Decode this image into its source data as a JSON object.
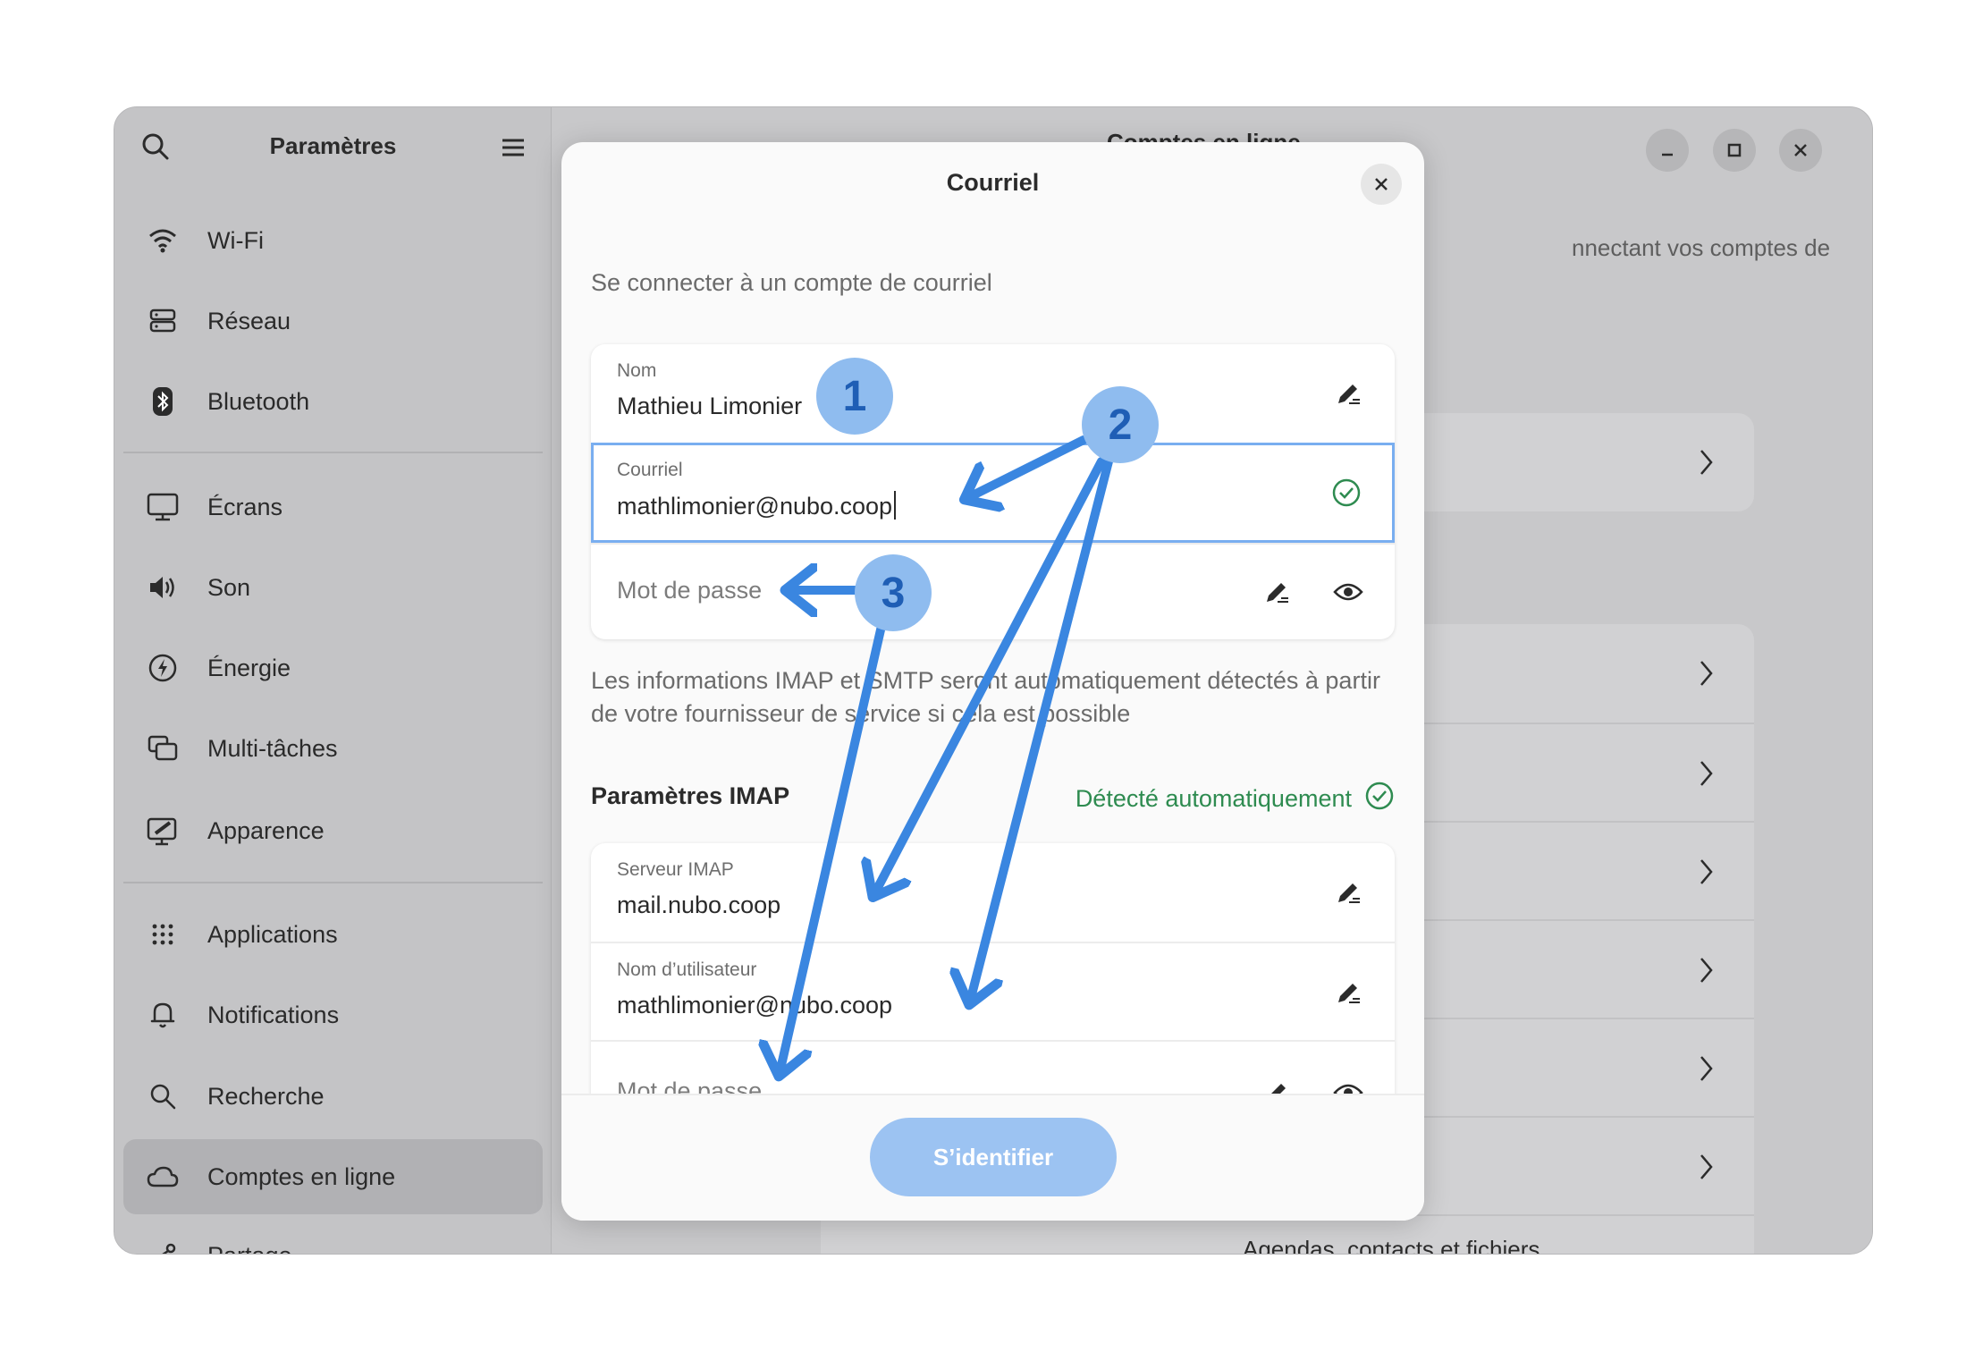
{
  "sidebar": {
    "title": "Paramètres",
    "items": [
      {
        "label": "Wi-Fi",
        "icon": "wifi-icon"
      },
      {
        "label": "Réseau",
        "icon": "network-icon"
      },
      {
        "label": "Bluetooth",
        "icon": "bluetooth-icon"
      },
      {
        "label": "Écrans",
        "icon": "display-icon"
      },
      {
        "label": "Son",
        "icon": "speaker-icon"
      },
      {
        "label": "Énergie",
        "icon": "power-icon"
      },
      {
        "label": "Multi-tâches",
        "icon": "multitask-icon"
      },
      {
        "label": "Apparence",
        "icon": "appearance-icon"
      },
      {
        "label": "Applications",
        "icon": "apps-grid-icon"
      },
      {
        "label": "Notifications",
        "icon": "bell-icon"
      },
      {
        "label": "Recherche",
        "icon": "search-icon"
      },
      {
        "label": "Comptes en ligne",
        "icon": "cloud-icon",
        "active": true
      },
      {
        "label": "Partage",
        "icon": "share-icon"
      }
    ]
  },
  "content": {
    "title": "Comptes en ligne",
    "description_fragment": "nnectant vos comptes de",
    "list_item_fragment": "Agendas, contacts et fichiers"
  },
  "dialog": {
    "title": "Courriel",
    "subtitle": "Se connecter à un compte de courriel",
    "fields": {
      "name": {
        "label": "Nom",
        "value": "Mathieu Limonier"
      },
      "email": {
        "label": "Courriel",
        "value": "mathlimonier@nubo.coop"
      },
      "password": {
        "placeholder": "Mot de passe"
      }
    },
    "info_text": "Les informations IMAP et SMTP seront automatiquement détectés à partir de votre fournisseur de service si cela est possible",
    "imap": {
      "section_title": "Paramètres IMAP",
      "detected_label": "Détecté automatiquement",
      "server": {
        "label": "Serveur IMAP",
        "value": "mail.nubo.coop"
      },
      "username": {
        "label": "Nom d’utilisateur",
        "value": "mathlimonier@nubo.coop"
      },
      "password": {
        "placeholder": "Mot de passe"
      }
    },
    "login_button": "S’identifier"
  },
  "annotations": {
    "badges": [
      "1",
      "2",
      "3"
    ],
    "colors": {
      "badge_fill": "#8fbcef",
      "badge_text": "#1f5eb5",
      "arrow": "#3a86e0"
    }
  },
  "colors": {
    "accent": "#79aef0",
    "success": "#2e8b50",
    "button": "#9cc3f2"
  }
}
